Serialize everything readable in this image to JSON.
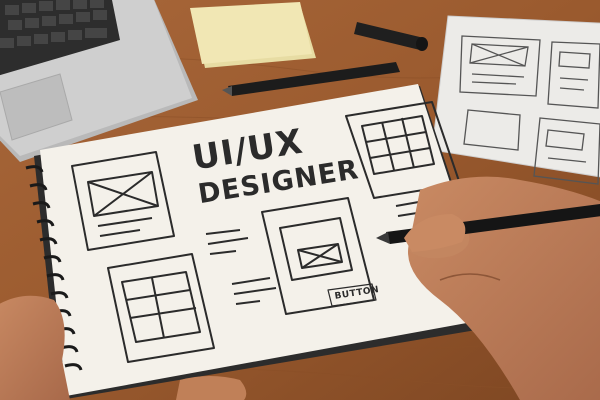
{
  "sketch": {
    "title_line1": "UI/UX",
    "title_line2": "DESIGNER",
    "button_label": "BUTTON"
  },
  "colors": {
    "desk": "#9a5a2e",
    "paper": "#f4f1ea",
    "ink": "#2b2b2b",
    "sticky_note": "#f1e7b4",
    "skin": "#b97855",
    "laptop": "#c8c8c8"
  },
  "icons": [
    "laptop",
    "sticky-note",
    "marker",
    "pen",
    "spiral-notebook",
    "wireframe-sheet",
    "hand"
  ]
}
